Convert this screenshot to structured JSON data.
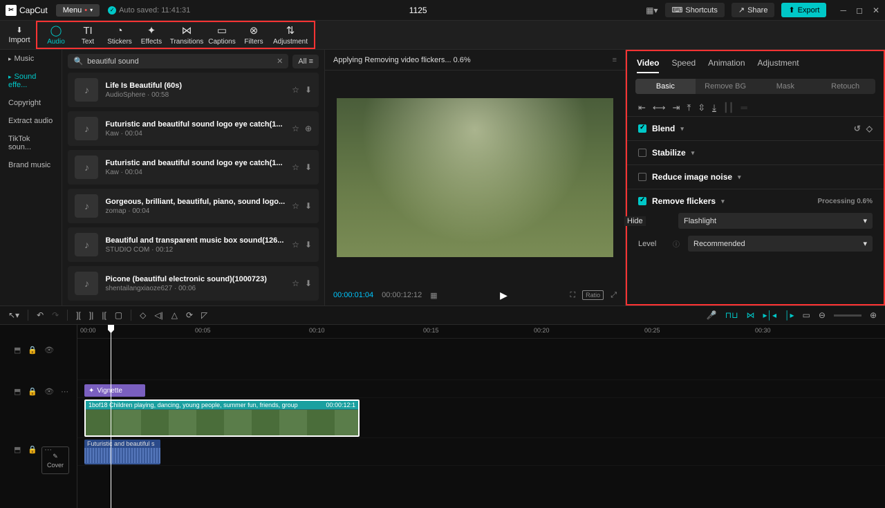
{
  "titlebar": {
    "app_name": "CapCut",
    "menu_label": "Menu",
    "autosave": "Auto saved: 11:41:31",
    "project_title": "1125",
    "shortcuts": "Shortcuts",
    "share": "Share",
    "export": "Export"
  },
  "toolbar": {
    "import": "Import",
    "tabs": [
      "Audio",
      "Text",
      "Stickers",
      "Effects",
      "Transitions",
      "Captions",
      "Filters",
      "Adjustment"
    ]
  },
  "sidebar": {
    "items": [
      "Music",
      "Sound effe...",
      "Copyright",
      "Extract audio",
      "TikTok soun...",
      "Brand music"
    ]
  },
  "search": {
    "query": "beautiful sound",
    "filter": "All"
  },
  "audio_list": [
    {
      "title": "Life Is Beautiful (60s)",
      "meta": "AudioSphere · 00:58"
    },
    {
      "title": "Futuristic and beautiful sound logo eye catch(1...",
      "meta": "Kaw · 00:04"
    },
    {
      "title": "Futuristic and beautiful sound logo eye catch(1...",
      "meta": "Kaw · 00:04"
    },
    {
      "title": "Gorgeous, brilliant, beautiful, piano, sound logo...",
      "meta": "zomap · 00:04"
    },
    {
      "title": "Beautiful and transparent music box sound(126...",
      "meta": "STUDIO COM · 00:12"
    },
    {
      "title": "Picone (beautiful electronic sound)(1000723)",
      "meta": "shentailangxiaoze627 · 00:06"
    }
  ],
  "preview": {
    "status": "Applying Removing video flickers... 0.6%",
    "time_current": "00:00:01:04",
    "time_total": "00:00:12:12",
    "ratio": "Ratio"
  },
  "inspector": {
    "tabs": [
      "Video",
      "Speed",
      "Animation",
      "Adjustment"
    ],
    "subtabs": [
      "Basic",
      "Remove BG",
      "Mask",
      "Retouch"
    ],
    "sections": {
      "blend": "Blend",
      "stabilize": "Stabilize",
      "reduce_noise": "Reduce image noise",
      "remove_flickers": "Remove flickers",
      "processing": "Processing 0.6%"
    },
    "flicker": {
      "hide_label": "Hide",
      "type_suffix": "e",
      "level_label": "Level",
      "type_value": "Flashlight",
      "level_value": "Recommended"
    }
  },
  "timeline": {
    "cover": "Cover",
    "ticks": [
      "00:00",
      "00:05",
      "00:10",
      "00:15",
      "00:20",
      "00:25",
      "00:30"
    ],
    "effect_clip": "Vignette",
    "video_clip_label": "1bof18 Children playing, dancing, young people, summer fun, friends, group",
    "video_clip_time": "00:00:12:1",
    "audio_clip_label": "Futuristic and beautiful s"
  }
}
